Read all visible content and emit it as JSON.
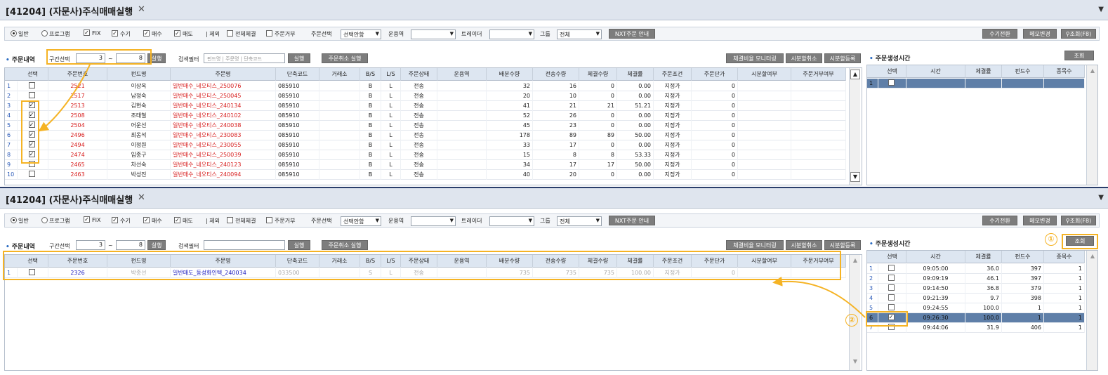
{
  "top": {
    "title": "[41204] (자문사)주식매매실행",
    "toolbar": {
      "radio_normal": "일반",
      "radio_program": "프로그램",
      "cb_fix": "FIX",
      "cb_manual": "수기",
      "cb_buy": "매수",
      "cb_sell": "매도",
      "exclude": "제외",
      "cb_all_exec": "전체체결",
      "cb_reject": "주문거부",
      "order_select_label": "주문선택",
      "order_select_value": "선택안함",
      "manager_label": "운용역",
      "manager_value": "",
      "trader_label": "트레이더",
      "trader_value": "",
      "group_label": "그룹",
      "group_value": "전체",
      "nxt_btn": "NXT주문 안내",
      "manual_switch": "수기전환",
      "memo_change": "메모변경",
      "query_f8": "조회(F8)"
    },
    "orders_title": "주문내역",
    "range_label": "구간선택",
    "range_from": "3",
    "range_to": "8",
    "run_btn": "실행",
    "filter_label": "검색필터",
    "filter_placeholder": "펀드명 | 주문명 | 단축코드",
    "filter_run": "실행",
    "cancel_run": "주문취소 실행",
    "btn_monitor": "체결비율 모니터링",
    "btn_split_cancel": "시분할취소",
    "btn_split_reg": "시분할등록",
    "headers": [
      "선택",
      "주문번호",
      "펀드명",
      "주문명",
      "단축코드",
      "거래소",
      "B/S",
      "L/S",
      "주문상태",
      "운용역",
      "배분수량",
      "전송수량",
      "체결수량",
      "체결률",
      "주문조건",
      "주문단가",
      "시분할여부",
      "주문거부여부"
    ],
    "rows": [
      {
        "n": "1",
        "chk": false,
        "no": "2521",
        "fund": "이상옥",
        "name": "일반매수_네오티스_250076",
        "code": "085910",
        "bs": "B",
        "ls": "L",
        "status": "전송",
        "alloc": "32",
        "sent": "16",
        "exec": "0",
        "rate": "0.00",
        "cond": "지정가",
        "price": "0"
      },
      {
        "n": "2",
        "chk": false,
        "no": "2517",
        "fund": "남정숙",
        "name": "일반매수_네오티스_250045",
        "code": "085910",
        "bs": "B",
        "ls": "L",
        "status": "전송",
        "alloc": "20",
        "sent": "10",
        "exec": "0",
        "rate": "0.00",
        "cond": "지정가",
        "price": "0"
      },
      {
        "n": "3",
        "chk": true,
        "no": "2513",
        "fund": "김현숙",
        "name": "일반매수_네오티스_240134",
        "code": "085910",
        "bs": "B",
        "ls": "L",
        "status": "전송",
        "alloc": "41",
        "sent": "21",
        "exec": "21",
        "rate": "51.21",
        "cond": "지정가",
        "price": "0"
      },
      {
        "n": "4",
        "chk": true,
        "no": "2508",
        "fund": "조태철",
        "name": "일반매수_네오티스_240102",
        "code": "085910",
        "bs": "B",
        "ls": "L",
        "status": "전송",
        "alloc": "52",
        "sent": "26",
        "exec": "0",
        "rate": "0.00",
        "cond": "지정가",
        "price": "0"
      },
      {
        "n": "5",
        "chk": true,
        "no": "2504",
        "fund": "어운선",
        "name": "일반매수_네오티스_240038",
        "code": "085910",
        "bs": "B",
        "ls": "L",
        "status": "전송",
        "alloc": "45",
        "sent": "23",
        "exec": "0",
        "rate": "0.00",
        "cond": "지정가",
        "price": "0"
      },
      {
        "n": "6",
        "chk": true,
        "no": "2496",
        "fund": "최옹석",
        "name": "일반매수_네오티스_230083",
        "code": "085910",
        "bs": "B",
        "ls": "L",
        "status": "전송",
        "alloc": "178",
        "sent": "89",
        "exec": "89",
        "rate": "50.00",
        "cond": "지정가",
        "price": "0"
      },
      {
        "n": "7",
        "chk": true,
        "no": "2494",
        "fund": "이정원",
        "name": "일반매수_네오티스_230055",
        "code": "085910",
        "bs": "B",
        "ls": "L",
        "status": "전송",
        "alloc": "33",
        "sent": "17",
        "exec": "0",
        "rate": "0.00",
        "cond": "지정가",
        "price": "0"
      },
      {
        "n": "8",
        "chk": true,
        "no": "2474",
        "fund": "임종구",
        "name": "일반매수_네오티스_250039",
        "code": "085910",
        "bs": "B",
        "ls": "L",
        "status": "전송",
        "alloc": "15",
        "sent": "8",
        "exec": "8",
        "rate": "53.33",
        "cond": "지정가",
        "price": "0"
      },
      {
        "n": "9",
        "chk": false,
        "no": "2465",
        "fund": "차선숙",
        "name": "일반매수_네오티스_240123",
        "code": "085910",
        "bs": "B",
        "ls": "L",
        "status": "전송",
        "alloc": "34",
        "sent": "17",
        "exec": "17",
        "rate": "50.00",
        "cond": "지정가",
        "price": "0"
      },
      {
        "n": "10",
        "chk": false,
        "no": "2463",
        "fund": "박성진",
        "name": "일반매수_네오티스_240094",
        "code": "085910",
        "bs": "B",
        "ls": "L",
        "status": "전송",
        "alloc": "40",
        "sent": "20",
        "exec": "0",
        "rate": "0.00",
        "cond": "지정가",
        "price": "0"
      }
    ],
    "side_title": "주문생성시간",
    "side_query": "조회",
    "side_headers": [
      "선택",
      "시간",
      "체결률",
      "펀드수",
      "종목수"
    ],
    "side_rows": [
      {
        "n": "1",
        "time": "",
        "rate": "",
        "funds": "",
        "items": ""
      }
    ]
  },
  "bottom": {
    "title": "[41204] (자문사)주식매매실행",
    "orders_title": "주문내역",
    "range_label": "구간선택",
    "range_from": "3",
    "range_to": "8",
    "run_btn": "실행",
    "filter_label": "검색필터",
    "filter_run": "실행",
    "cancel_run": "주문취소 실행",
    "btn_monitor": "체결비율 모니터링",
    "btn_split_cancel": "시분할취소",
    "btn_split_reg": "시분할등록",
    "rows": [
      {
        "n": "1",
        "chk": false,
        "no": "2326",
        "fund": "박종선",
        "name": "일반매도_동성화인텍_240034",
        "code": "033500",
        "bs": "S",
        "ls": "L",
        "status": "전송",
        "alloc": "735",
        "sent": "735",
        "exec": "735",
        "rate": "100.00",
        "cond": "지정가",
        "price": "0"
      }
    ],
    "side_title": "주문생성시간",
    "side_query": "조회",
    "side_rows": [
      {
        "n": "1",
        "chk": false,
        "time": "09:05:00",
        "rate": "36.0",
        "funds": "397",
        "items": "1"
      },
      {
        "n": "2",
        "chk": false,
        "time": "09:09:19",
        "rate": "46.1",
        "funds": "397",
        "items": "1"
      },
      {
        "n": "3",
        "chk": false,
        "time": "09:14:50",
        "rate": "36.8",
        "funds": "379",
        "items": "1"
      },
      {
        "n": "4",
        "chk": false,
        "time": "09:21:39",
        "rate": "9.7",
        "funds": "398",
        "items": "1"
      },
      {
        "n": "5",
        "chk": false,
        "time": "09:24:55",
        "rate": "100.0",
        "funds": "1",
        "items": "1"
      },
      {
        "n": "6",
        "chk": true,
        "time": "09:26:30",
        "rate": "100.0",
        "funds": "1",
        "items": "1"
      },
      {
        "n": "7",
        "chk": false,
        "time": "09:44:06",
        "rate": "31.9",
        "funds": "406",
        "items": "1"
      }
    ],
    "marker1": "①",
    "marker2": "②"
  },
  "colors": {
    "highlight": "#f5b324",
    "selected_row": "#5f7fa8",
    "header_bg": "#dde6f1",
    "link_red": "#d82020"
  }
}
